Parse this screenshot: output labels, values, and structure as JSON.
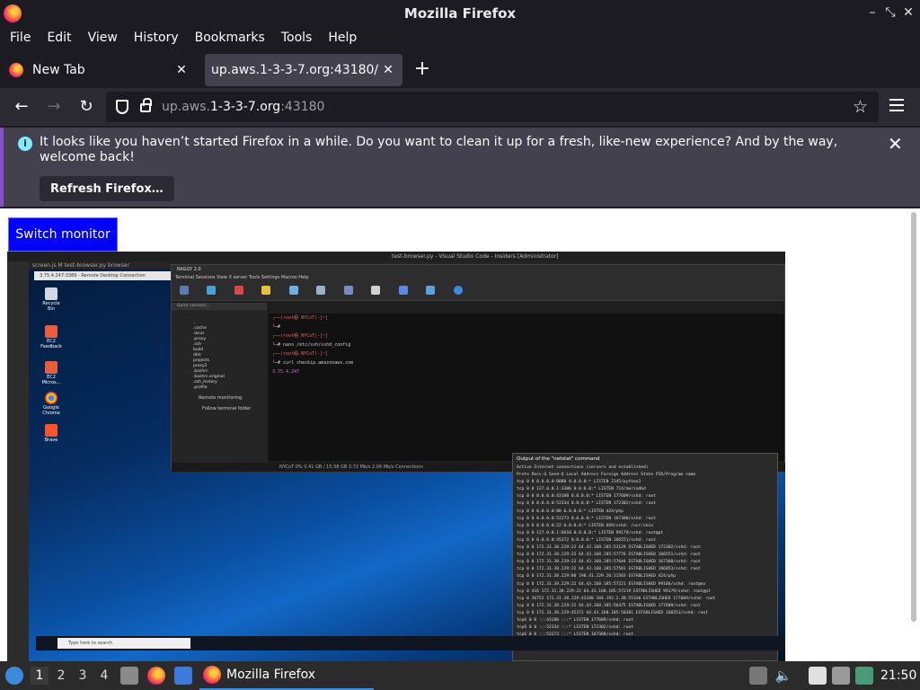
{
  "window": {
    "title": "Mozilla Firefox"
  },
  "menu": [
    "File",
    "Edit",
    "View",
    "History",
    "Bookmarks",
    "Tools",
    "Help"
  ],
  "tabs": [
    {
      "label": "New Tab"
    },
    {
      "label": "up.aws.1-3-3-7.org:43180/"
    }
  ],
  "urlbar": {
    "host_prefix": "up.aws.",
    "host_main": "1-3-3-7.org",
    "port": ":43180"
  },
  "notice": {
    "text": "It looks like you haven’t started Firefox in a while. Do you want to clean it up for a fresh, like-new experience? And by the way, welcome back!",
    "button": "Refresh Firefox…"
  },
  "page": {
    "switch_button": "Switch monitor"
  },
  "remote": {
    "vscode_title": "test-browser.py - Visual Studio Code - Insiders [Administrator]",
    "vscode_tabs": "screen.js M   test-browser.py   browser",
    "rdp_title": "3.75.4.247:3389 - Remote Desktop Connection",
    "desktop_icons": [
      "Recycle Bin",
      "EC2 Feedback",
      "EC2 Micros...",
      "Google Chrome",
      "Brave"
    ],
    "search_placeholder": "Type here to search",
    "raggy_title": "RAGGY 2.0",
    "raggy_menu": "Terminal  Sessions  View  X server  Tools  Settings  Macros  Help",
    "raggy_tree": [
      "..",
      ".cache",
      ".local",
      ".proxy",
      ".ssh",
      "build",
      "dist",
      "projects",
      "proxy2",
      ".bashrc",
      ".bashrc.original",
      ".zsh_history",
      ".profile"
    ],
    "raggy_quick": "Quick connect...",
    "raggy_remote": "Remote monitoring",
    "raggy_follow": "Follow terminal folder",
    "terminal": [
      "┌──(root㉿ NYCoT)-[~]",
      "└─#",
      "┌──(root㉿ NYCoT)-[~]",
      "└─# nano /etc/ssh/sshd_config",
      "┌──(root㉿ NYCoT)-[~]",
      "└─# curl checkip.amazonaws.com",
      "3.75.4.247"
    ],
    "status": "NYCoT   0%   0.41 GB / 15.58 GB   3.72 Mb/s   2.06 Mb/s   Connections",
    "netstat_title": "Output of the \"netstat\" command",
    "netstat": [
      "Active Internet connections (servers and established)",
      "Proto Recv-Q Send-Q Local Address Foreign Address State PID/Program name",
      "tcp 0 0 0.0.0.0:8000 0.0.0.0:* LISTEN 2145/python3",
      "tcp 0 0 127.0.0.1:3306 0.0.0.0:* LISTEN 714/mariadbd",
      "tcp 0 0 0.0.0.0:43180 0.0.0.0:* LISTEN 177609/sshd: root",
      "tcp 0 0 0.0.0.0:52334 0.0.0.0:* LISTEN 172302/sshd: root",
      "tcp 0 0 0.0.0.0:80 0.0.0.0:* LISTEN 424/php",
      "tcp 0 0 0.0.0.0:52273 0.0.0.0:* LISTEN 167308/sshd: root",
      "tcp 0 0 0.0.0.0:22 0.0.0.0:* LISTEN 669/sshd: /usr/sbin",
      "tcp 0 0 127.0.0.1:6010 0.0.0.0:* LISTEN 99179/sshd: root@pt",
      "tcp 0 0 0.0.0.0:45372 0.0.0.0:* LISTEN 166551/sshd: root",
      "tcp 0 0 172.31.38.229:22 64.43.168.185:53129 ESTABLISHED 172302/sshd: root",
      "tcp 0 0 172.31.38.229:22 64.43.168.185:57776 ESTABLISHED 166551/sshd: root",
      "tcp 0 0 172.31.38.229:22 64.43.168.185:57644 ESTABLISHED 167308/sshd: root",
      "tcp 0 0 172.31.38.229:22 64.43.168.185:57581 ESTABLISHED 166053/sshd: root",
      "tcp 0 0 172.31.38.229:80 198.41.229.26:11563 ESTABLISHED 424/php",
      "tcp 0 0 172.31.38.229:22 64.43.168.185:57221 ESTABLISHED 99186/sshd: root@no",
      "tcp 0 416 172.31.38.229:22 64.43.168.185:57219 ESTABLISHED 99179/sshd: root@pt",
      "tcp 0 36752 172.31.38.229:43180 104.192.2.38:55338 ESTABLISHED 177609/sshd: root",
      "tcp 0 0 172.31.38.229:22 64.43.168.185:56475 ESTABLISHED 177609/sshd: root",
      "tcp 0 0 172.31.38.229:45372 64.43.168.185:50381 ESTABLISHED 166551/sshd: root",
      "tcp6 0 0 :::43180 :::* LISTEN 177609/sshd: root",
      "tcp6 0 0 :::52334 :::* LISTEN 172302/sshd: root",
      "tcp6 0 0 :::52273 :::* LISTEN 167308/sshd: root",
      "tcp6 0 0 :::22 :::* LISTEN 669/sshd: /usr/sbin"
    ]
  },
  "panel": {
    "workspaces": [
      "1",
      "2",
      "3",
      "4"
    ],
    "task_label": "Mozilla Firefox",
    "clock": "21:50"
  }
}
